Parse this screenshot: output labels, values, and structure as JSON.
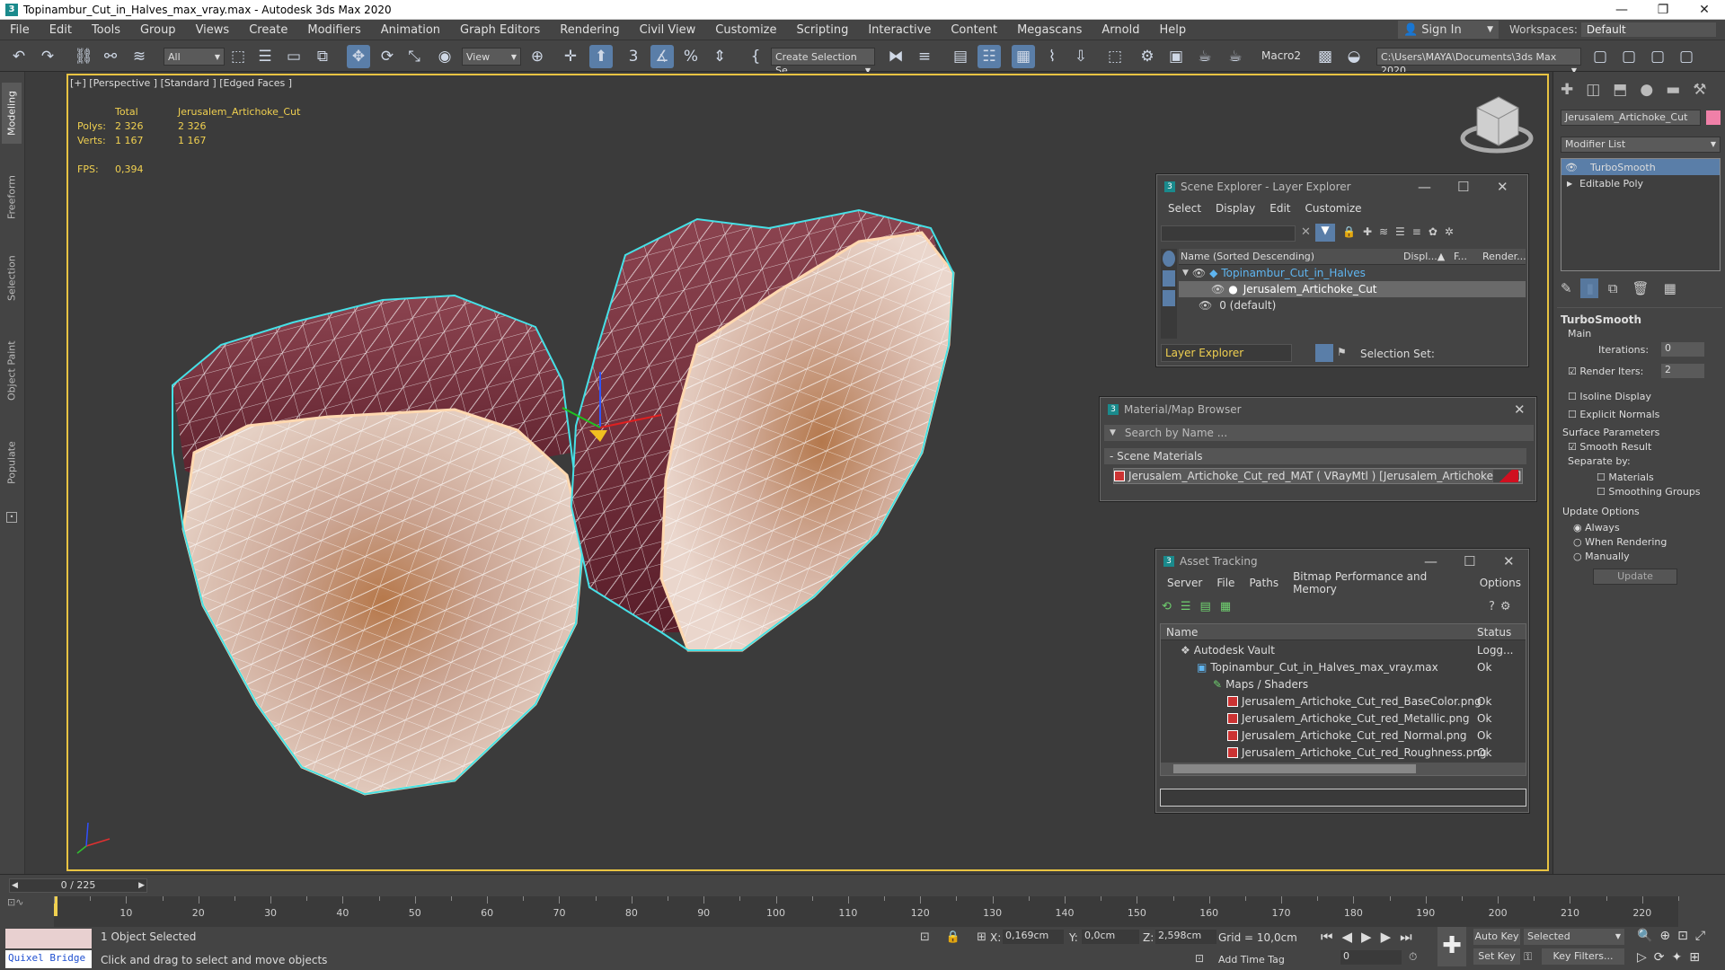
{
  "window": {
    "title": "Topinambur_Cut_in_Halves_max_vray.max - Autodesk 3ds Max 2020",
    "app_icon": "3"
  },
  "menu": {
    "items": [
      "File",
      "Edit",
      "Tools",
      "Group",
      "Views",
      "Create",
      "Modifiers",
      "Animation",
      "Graph Editors",
      "Rendering",
      "Civil View",
      "Customize",
      "Scripting",
      "Interactive",
      "Content",
      "Megascans",
      "Arnold",
      "Help"
    ],
    "sign_in": "Sign In",
    "workspaces_label": "Workspaces:",
    "workspace_value": "Default"
  },
  "toolbar": {
    "selection_filter": "All",
    "reference_coord": "View",
    "named_selection": "Create Selection Se",
    "macro": "Macro2",
    "project_path": "C:\\Users\\MAYA\\Documents\\3ds Max 2020"
  },
  "left_tabs": [
    "Modeling",
    "Freeform",
    "Selection",
    "Object Paint",
    "Populate"
  ],
  "viewport": {
    "label": "[+] [Perspective ] [Standard ] [Edged Faces ]",
    "stats": {
      "col_total": "Total",
      "col_object": "Jerusalem_Artichoke_Cut",
      "polys_label": "Polys:",
      "polys_total": "2 326",
      "polys_obj": "2 326",
      "verts_label": "Verts:",
      "verts_total": "1 167",
      "verts_obj": "1 167",
      "fps_label": "FPS:",
      "fps_value": "0,394"
    }
  },
  "scene_explorer": {
    "title": "Scene Explorer - Layer Explorer",
    "menu": [
      "Select",
      "Display",
      "Edit",
      "Customize"
    ],
    "col_name": "Name (Sorted Descending)",
    "col_disp": "Displ...▲",
    "col_f": "F...",
    "col_render": "Render...",
    "rows": [
      {
        "label": "Topinambur_Cut_in_Halves"
      },
      {
        "label": "Jerusalem_Artichoke_Cut"
      },
      {
        "label": "0 (default)"
      }
    ],
    "footer_dropdown": "Layer Explorer",
    "selection_set": "Selection Set:"
  },
  "material_browser": {
    "title": "Material/Map Browser",
    "search_placeholder": "Search by Name ...",
    "section": "- Scene Materials",
    "material": "Jerusalem_Artichoke_Cut_red_MAT  ( VRayMtl )  [Jerusalem_Artichoke_Cut]"
  },
  "asset_tracking": {
    "title": "Asset Tracking",
    "menu": [
      "Server",
      "File",
      "Paths",
      "Bitmap Performance and Memory",
      "Options"
    ],
    "col_name": "Name",
    "col_status": "Status",
    "rows": [
      {
        "name": "Autodesk Vault",
        "status": "Logg..."
      },
      {
        "name": "Topinambur_Cut_in_Halves_max_vray.max",
        "status": "Ok"
      },
      {
        "name": "Maps / Shaders",
        "status": ""
      },
      {
        "name": "Jerusalem_Artichoke_Cut_red_BaseColor.png",
        "status": "Ok"
      },
      {
        "name": "Jerusalem_Artichoke_Cut_red_Metallic.png",
        "status": "Ok"
      },
      {
        "name": "Jerusalem_Artichoke_Cut_red_Normal.png",
        "status": "Ok"
      },
      {
        "name": "Jerusalem_Artichoke_Cut_red_Roughness.png",
        "status": "Ok"
      }
    ]
  },
  "command_panel": {
    "object_name": "Jerusalem_Artichoke_Cut",
    "modifier_list": "Modifier List",
    "stack": [
      "TurboSmooth",
      "Editable Poly"
    ],
    "rollout_title": "TurboSmooth",
    "main": "Main",
    "iterations_label": "Iterations:",
    "iterations_value": "0",
    "render_iters_label": "Render Iters:",
    "render_iters_value": "2",
    "isoline": "Isoline Display",
    "explicit": "Explicit Normals",
    "surface": "Surface Parameters",
    "smooth_result": "Smooth Result",
    "separate_by": "Separate by:",
    "materials": "Materials",
    "smoothing_groups": "Smoothing Groups",
    "update_options": "Update Options",
    "always": "Always",
    "when_rendering": "When Rendering",
    "manually": "Manually",
    "update_btn": "Update"
  },
  "timeline": {
    "frame_readout": "0 / 225",
    "ticks": [
      "10",
      "20",
      "30",
      "40",
      "50",
      "60",
      "70",
      "80",
      "90",
      "100",
      "110",
      "120",
      "130",
      "140",
      "150",
      "160",
      "170",
      "180",
      "190",
      "200",
      "210",
      "220"
    ]
  },
  "status": {
    "quixel": "Quixel Bridge",
    "selected": "1 Object Selected",
    "hint": "Click and drag to select and move objects",
    "x_label": "X:",
    "x_val": "0,169cm",
    "y_label": "Y:",
    "y_val": "0,0cm",
    "z_label": "Z:",
    "z_val": "2,598cm",
    "grid": "Grid = 10,0cm",
    "add_time_tag": "Add Time Tag",
    "auto_key": "Auto Key",
    "set_key": "Set Key",
    "key_mode": "Selected",
    "key_filters": "Key Filters...",
    "frame_value": "0"
  },
  "colors": {
    "accent": "#5a7ea8",
    "viewport_border": "#e8c342",
    "stats": "#f0d050",
    "selection_blue": "#5fb5f0"
  }
}
